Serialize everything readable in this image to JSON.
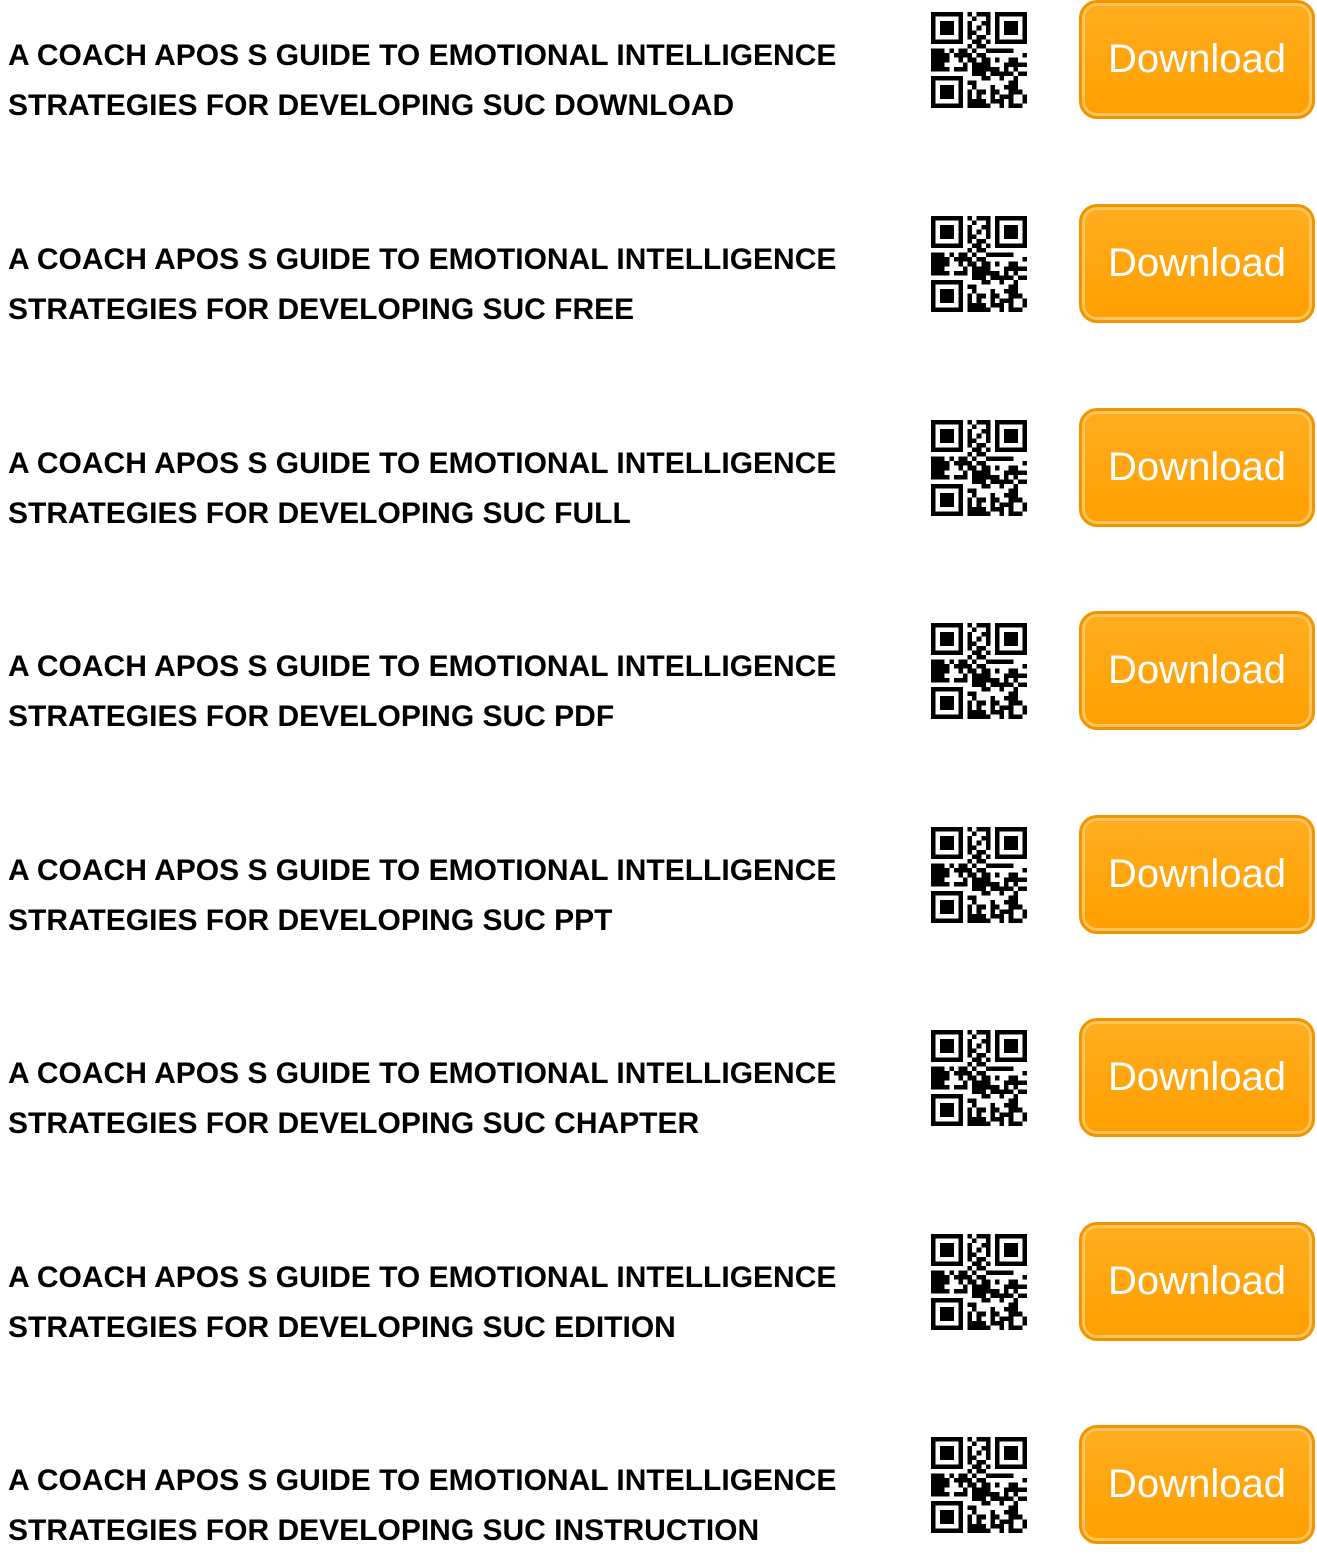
{
  "colors": {
    "button_fill": "#ffa40c",
    "button_border": "#f29400",
    "title_text": "#000000"
  },
  "qr_icon": "qr-code-icon",
  "items": [
    {
      "line1": "A COACH APOS S GUIDE TO EMOTIONAL INTELLIGENCE",
      "line2": "STRATEGIES FOR DEVELOPING SUC DOWNLOAD",
      "button_label": "Download"
    },
    {
      "line1": "A COACH APOS S GUIDE TO EMOTIONAL INTELLIGENCE",
      "line2": "STRATEGIES FOR DEVELOPING SUC FREE",
      "button_label": "Download"
    },
    {
      "line1": "A COACH APOS S GUIDE TO EMOTIONAL INTELLIGENCE",
      "line2": "STRATEGIES FOR DEVELOPING SUC FULL",
      "button_label": "Download"
    },
    {
      "line1": "A COACH APOS S GUIDE TO EMOTIONAL INTELLIGENCE",
      "line2": "STRATEGIES FOR DEVELOPING SUC PDF",
      "button_label": "Download"
    },
    {
      "line1": "A COACH APOS S GUIDE TO EMOTIONAL INTELLIGENCE",
      "line2": "STRATEGIES FOR DEVELOPING SUC PPT",
      "button_label": "Download"
    },
    {
      "line1": "A COACH APOS S GUIDE TO EMOTIONAL INTELLIGENCE",
      "line2": "STRATEGIES FOR DEVELOPING SUC CHAPTER",
      "button_label": "Download"
    },
    {
      "line1": "A COACH APOS S GUIDE TO EMOTIONAL INTELLIGENCE",
      "line2": "STRATEGIES FOR DEVELOPING SUC EDITION",
      "button_label": "Download"
    },
    {
      "line1": "A COACH APOS S GUIDE TO EMOTIONAL INTELLIGENCE",
      "line2": "STRATEGIES FOR DEVELOPING SUC INSTRUCTION",
      "button_label": "Download"
    }
  ]
}
